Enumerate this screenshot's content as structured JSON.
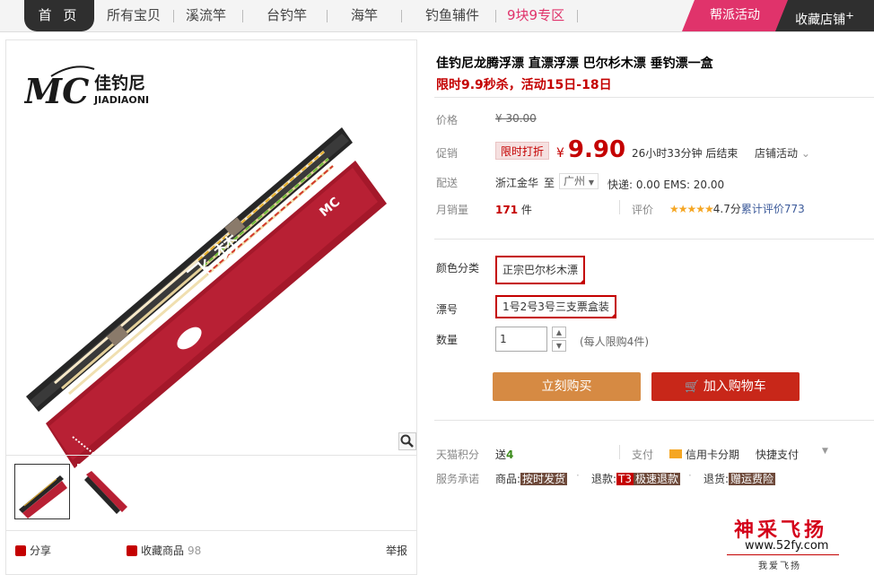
{
  "nav": {
    "home": "首 页",
    "items": [
      "所有宝贝",
      "溪流竿",
      "台钓竿",
      "海竿",
      "钓鱼辅件",
      "9块9专区"
    ],
    "promo": "帮派活动",
    "favorite_shop": "收藏店铺",
    "favorite_plus": "+"
  },
  "gallery": {
    "logo_brand": "佳钓尼",
    "logo_pinyin": "JIADIAONI",
    "logo_mark": "MC",
    "share": "分享",
    "favorite": "收藏商品",
    "favorite_count": "98",
    "report": "举报"
  },
  "product": {
    "title": "佳钓尼龙腾浮漂 直漂浮漂 巴尔杉木漂 垂钓漂一盒",
    "subtitle": "限时9.9秒杀，活动15日-18日"
  },
  "price": {
    "label": "价格",
    "original": "¥ 30.00",
    "promo_label": "促销",
    "promo_tag": "限时打折",
    "yen": "¥",
    "current": "9.90",
    "countdown": "26小时33分钟 后结束",
    "shop_activity": "店铺活动",
    "chevron": "⌄"
  },
  "delivery": {
    "label": "配送",
    "from": "浙江金华",
    "to_word": "至",
    "city": "广州",
    "fees": "快递: 0.00 EMS: 20.00"
  },
  "sales": {
    "label": "月销量",
    "count": "171",
    "unit": "件",
    "rating_label": "评价",
    "stars": "★★★★★",
    "score": "4.7分",
    "reviews": "累计评价773"
  },
  "sku": {
    "color_label": "颜色分类",
    "color_value": "正宗巴尔杉木漂",
    "float_label": "漂号",
    "float_value": "1号2号3号三支票盒装",
    "qty_label": "数量",
    "qty_value": "1",
    "qty_up": "▲",
    "qty_down": "▼",
    "limit": "(每人限购4件)"
  },
  "buttons": {
    "buy_now": "立刻购买",
    "add_to_cart": "加入购物车"
  },
  "service": {
    "points_label": "天猫积分",
    "points_prefix": "送",
    "points_value": "4",
    "pay_label": "支付",
    "credit": "信用卡分期",
    "quick_pay": "快捷支付",
    "promise_label": "服务承诺",
    "goods_label": "商品:",
    "goods_badge": "按时发货",
    "refund_label": "退款:",
    "refund_t3": "T3",
    "refund_badge": "极速退款",
    "return_label": "退货:",
    "return_badge": "赠运费险"
  },
  "watermark": {
    "name": "神采飞扬",
    "url": "www.52fy.com",
    "slogan": "我爱飞扬"
  }
}
